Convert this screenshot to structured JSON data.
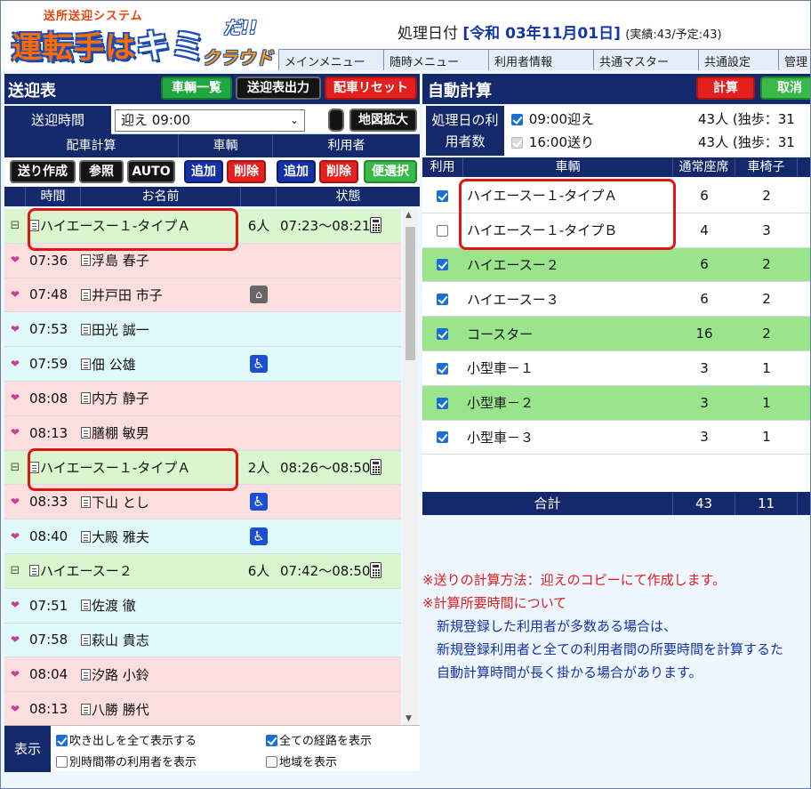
{
  "header": {
    "logo_small": "送所送迎システム",
    "logo_main": "運転手は",
    "logo_ki": "キミ",
    "logo_da": "だ!!",
    "logo_cloud": "クラウド",
    "proc_date_label": "処理日付",
    "proc_date_value": "[令和 03年11月01日]",
    "proc_date_counts": "(実績:43/予定:43)",
    "menu": [
      "メインメニュー",
      "随時メニュー",
      "利用者情報",
      "共通マスター",
      "共通設定",
      "管理"
    ]
  },
  "left": {
    "title": "送迎表",
    "buttons": {
      "vehicles": "車輌一覧",
      "output": "送迎表出力",
      "reset": "配車リセット"
    },
    "time_label": "送迎時間",
    "time_value": "迎え 09:00",
    "map_button": "地図拡大",
    "sections": {
      "calc": "配車計算",
      "vehicle": "車輌",
      "user": "利用者"
    },
    "action_buttons": {
      "send_create": "送り作成",
      "ref": "参照",
      "auto": "AUTO",
      "v_add": "追加",
      "v_del": "削除",
      "u_add": "追加",
      "u_del": "削除",
      "convenient": "便選択"
    },
    "columns": {
      "time": "時間",
      "name": "お名前",
      "status": "状態"
    },
    "rows": [
      {
        "type": "group",
        "name": "ハイエースー１-タイプＡ",
        "count": "6人",
        "status": "07:23～08:21"
      },
      {
        "type": "pink",
        "time": "07:36",
        "name": "浮島 春子",
        "icon": ""
      },
      {
        "type": "pink",
        "time": "07:48",
        "name": "井戸田 市子",
        "icon": "stretcher"
      },
      {
        "type": "cyan",
        "time": "07:53",
        "name": "田光 誠一",
        "icon": ""
      },
      {
        "type": "cyan",
        "time": "07:59",
        "name": "佃 公雄",
        "icon": "wheelchair"
      },
      {
        "type": "pink",
        "time": "08:08",
        "name": "内方 静子",
        "icon": ""
      },
      {
        "type": "pink",
        "time": "08:13",
        "name": "膳棚 敏男",
        "icon": ""
      },
      {
        "type": "group",
        "name": "ハイエースー１-タイプＡ",
        "count": "2人",
        "status": "08:26～08:50"
      },
      {
        "type": "pink",
        "time": "08:33",
        "name": "下山 とし",
        "icon": "wheelchair"
      },
      {
        "type": "cyan",
        "time": "08:40",
        "name": "大殿 雅夫",
        "icon": "wheelchair"
      },
      {
        "type": "group",
        "name": "ハイエースー２",
        "count": "6人",
        "status": "07:42～08:50"
      },
      {
        "type": "cyan",
        "time": "07:51",
        "name": "佐渡 徹",
        "icon": ""
      },
      {
        "type": "cyan",
        "time": "07:58",
        "name": "萩山 貴志",
        "icon": ""
      },
      {
        "type": "pink",
        "time": "08:04",
        "name": "汐路 小鈴",
        "icon": ""
      },
      {
        "type": "pink",
        "time": "08:13",
        "name": "八勝 勝代",
        "icon": ""
      }
    ],
    "display_label": "表示",
    "display_opts": [
      {
        "label": "吹き出しを全て表示する",
        "checked": true
      },
      {
        "label": "全ての経路を表示",
        "checked": true
      },
      {
        "label": "別時間帯の利用者を表示",
        "checked": false
      },
      {
        "label": "地域を表示",
        "checked": false
      }
    ]
  },
  "right": {
    "title": "自動計算",
    "calc_button": "計算",
    "cancel_button": "取消",
    "proc_label": "処理日の利用者数",
    "proc_lines": [
      {
        "label": "09:00迎え",
        "count": "43人 (独歩：31"
      },
      {
        "label": "16:00送り",
        "count": "43人 (独歩：31"
      }
    ],
    "columns": {
      "use": "利用",
      "vehicle": "車輌",
      "seats": "通常座席",
      "wheel": "車椅子"
    },
    "vehicles": [
      {
        "name": "ハイエースー１-タイプＡ",
        "seats": "6",
        "wheel": "2",
        "checked": true,
        "green": false
      },
      {
        "name": "ハイエースー１-タイプＢ",
        "seats": "4",
        "wheel": "3",
        "checked": false,
        "green": false
      },
      {
        "name": "ハイエースー２",
        "seats": "6",
        "wheel": "2",
        "checked": true,
        "green": true
      },
      {
        "name": "ハイエースー３",
        "seats": "6",
        "wheel": "2",
        "checked": true,
        "green": false
      },
      {
        "name": "コースター",
        "seats": "16",
        "wheel": "2",
        "checked": true,
        "green": true
      },
      {
        "name": "小型車－１",
        "seats": "3",
        "wheel": "1",
        "checked": true,
        "green": false
      },
      {
        "name": "小型車－２",
        "seats": "3",
        "wheel": "1",
        "checked": true,
        "green": true
      },
      {
        "name": "小型車－３",
        "seats": "3",
        "wheel": "1",
        "checked": true,
        "green": false
      }
    ],
    "total_label": "合計",
    "total_seats": "43",
    "total_wheel": "11",
    "notes": [
      {
        "cls": "red",
        "text": "※送りの計算方法：迎えのコピーにて作成します。"
      },
      {
        "cls": "red",
        "text": "※計算所要時間について"
      },
      {
        "cls": "blue",
        "text": "新規登録した利用者が多数ある場合は、"
      },
      {
        "cls": "blue",
        "text": "新規登録利用者と全ての利用者間の所要時間を計算するた"
      },
      {
        "cls": "blue",
        "text": "自動計算時間が長く掛かる場合があります。"
      }
    ]
  }
}
